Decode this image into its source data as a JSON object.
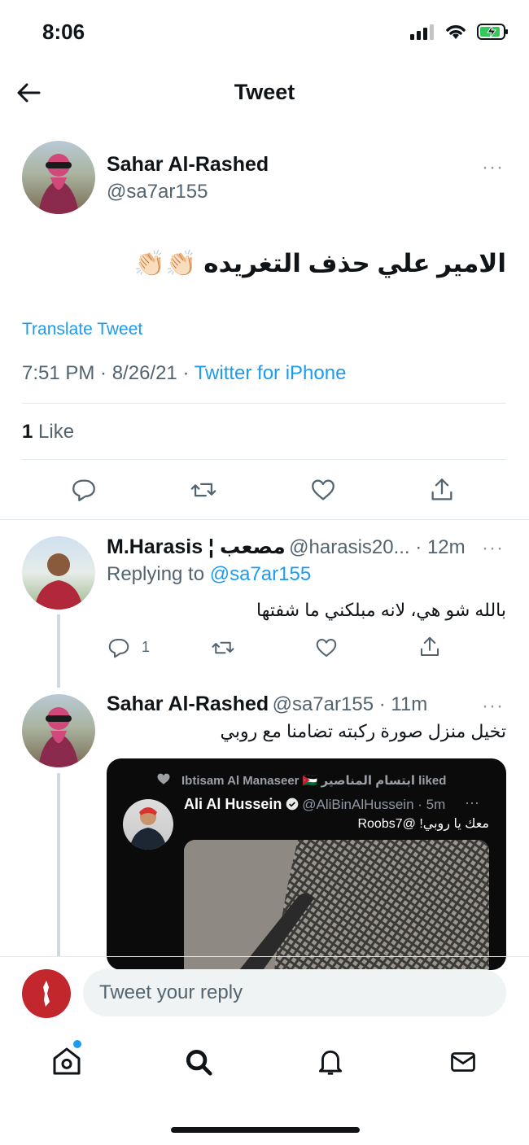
{
  "status_bar": {
    "time": "8:06"
  },
  "header": {
    "title": "Tweet"
  },
  "main_tweet": {
    "author_name": "Sahar Al-Rashed",
    "author_handle": "@sa7ar155",
    "more": "···",
    "text": "الامير علي حذف التغريده 👏🏻👏🏻",
    "translate": "Translate Tweet",
    "time": "7:51 PM · 8/26/21 · ",
    "source": "Twitter for iPhone",
    "likes_count": "1",
    "likes_label": " Like"
  },
  "replies": [
    {
      "author_name": "M.Harasis ¦ مصعب",
      "author_handle": "@harasis20...",
      "time": " · 12m",
      "replying_prefix": "Replying to ",
      "replying_to": "@sa7ar155",
      "text": "بالله شو هي، لانه مبلكني ما شفتها",
      "reply_count": "1"
    },
    {
      "author_name": "Sahar Al-Rashed",
      "author_handle": "@sa7ar155",
      "time": " · 11m",
      "text": "تخيل منزل صورة ركبته تضامنا مع روبي",
      "embed": {
        "liked_by": "Ibtisam Al Manaseer 🇯🇴 ابتسام المناصير liked",
        "author_name": "Ali Al Hussein",
        "author_handle": "@AliBinAlHussein · 5m",
        "text": "معك يا روبي! @Roobs7"
      }
    }
  ],
  "reply_input": {
    "placeholder": "Tweet your reply"
  },
  "colors": {
    "accent": "#1d9bf0",
    "text": "#0f1419",
    "muted": "#536471"
  },
  "icons": [
    "back-arrow-icon",
    "reply-icon",
    "retweet-icon",
    "like-icon",
    "share-icon",
    "home-icon",
    "search-icon",
    "notifications-icon",
    "messages-icon"
  ]
}
